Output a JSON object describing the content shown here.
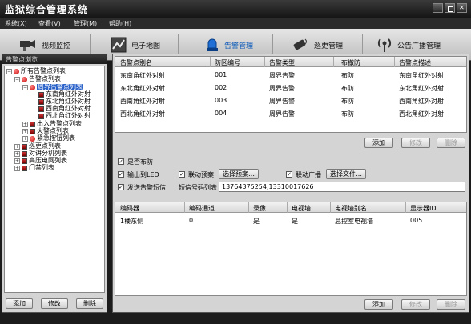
{
  "app": {
    "title": "监狱综合管理系统"
  },
  "menu": [
    {
      "label": "系统(X)"
    },
    {
      "label": "查看(V)"
    },
    {
      "label": "管理(M)"
    },
    {
      "label": "帮助(H)"
    }
  ],
  "toolbar": {
    "items": [
      {
        "label": "视频监控",
        "icon": "camera-icon"
      },
      {
        "label": "电子地图",
        "icon": "map-icon"
      },
      {
        "label": "告警管理",
        "icon": "alarm-light-icon",
        "active": true
      },
      {
        "label": "巡更管理",
        "icon": "patrol-icon"
      },
      {
        "label": "公告广播管理",
        "icon": "broadcast-icon"
      }
    ],
    "active_color": "#0a58b8"
  },
  "left": {
    "header": "告警点浏览",
    "tree": [
      {
        "label": "所有告警点列表",
        "expander": "−",
        "icon": "red"
      },
      {
        "label": "告警点列表",
        "expander": "−",
        "icon": "red"
      },
      {
        "label": "周界告警点列表",
        "expander": "−",
        "icon": "red",
        "selected": true
      },
      {
        "label": "东南角红外对射",
        "icon": "small"
      },
      {
        "label": "东北角红外对射",
        "icon": "small"
      },
      {
        "label": "西南角红外对射",
        "icon": "small"
      },
      {
        "label": "西北角红外对射",
        "icon": "small"
      },
      {
        "label": "出入告警点列表",
        "expander": "+",
        "icon": "small"
      },
      {
        "label": "火警点列表",
        "expander": "+",
        "icon": "small"
      },
      {
        "label": "紧急按钮列表",
        "expander": "+",
        "icon": "red"
      },
      {
        "label": "巡更点列表",
        "expander": "+",
        "icon": "small"
      },
      {
        "label": "对讲分机列表",
        "expander": "+",
        "icon": "small"
      },
      {
        "label": "高压电网列表",
        "expander": "+",
        "icon": "small"
      },
      {
        "label": "门禁列表",
        "expander": "+",
        "icon": "small"
      }
    ],
    "buttons": {
      "add": "添加",
      "edit": "修改",
      "delete": "删除"
    }
  },
  "alarm_table": {
    "columns": [
      "告警点别名",
      "防区编号",
      "告警类型",
      "布撤防",
      "告警点描述"
    ],
    "rows": [
      [
        "东南角红外对射",
        "001",
        "周界告警",
        "布防",
        "东南角红外对射"
      ],
      [
        "东北角红外对射",
        "002",
        "周界告警",
        "布防",
        "东北角红外对射"
      ],
      [
        "西南角红外对射",
        "003",
        "周界告警",
        "布防",
        "西南角红外对射"
      ],
      [
        "西北角红外对射",
        "004",
        "周界告警",
        "布防",
        "西北角红外对射"
      ]
    ]
  },
  "alarm_buttons": {
    "add": "添加",
    "edit": "修改",
    "delete": "删除"
  },
  "options": {
    "arm": {
      "label": "是否布防",
      "checked": true
    },
    "output_led": {
      "label": "输出到LED",
      "checked": true
    },
    "linked_preset": {
      "label": "联动预案",
      "checked": true
    },
    "choose_preset": "选择预案…",
    "linked_broadcast": {
      "label": "联动广播",
      "checked": true
    },
    "choose_file": "选择文件…",
    "send_sms": {
      "label": "发送告警短信",
      "checked": true
    },
    "sms_list_label": "短信号码列表",
    "sms_numbers": "13764375254,13310017626"
  },
  "tv_table": {
    "columns": [
      "编码器",
      "编码通道",
      "录像",
      "电视墙",
      "电视墙别名",
      "显示器ID"
    ],
    "rows": [
      [
        "1楼东侧",
        "0",
        "是",
        "是",
        "总控室电视墙",
        "005"
      ]
    ]
  },
  "tv_buttons": {
    "add": "添加",
    "edit": "修改",
    "delete": "删除"
  }
}
